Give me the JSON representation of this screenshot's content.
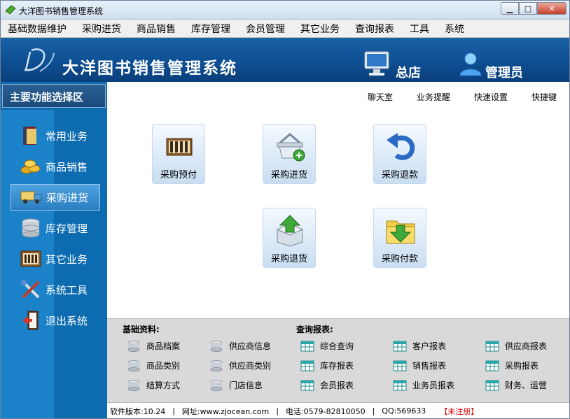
{
  "window": {
    "title": "大洋图书销售管理系统"
  },
  "menubar": {
    "items": [
      "基础数据维护",
      "采购进货",
      "商品销售",
      "库存管理",
      "会员管理",
      "其它业务",
      "查询报表",
      "工具",
      "系统"
    ]
  },
  "banner": {
    "title": "大洋图书销售管理系统",
    "branch": "总店",
    "role": "管理员"
  },
  "sidebar": {
    "header": "主要功能选择区",
    "items": [
      {
        "label": "常用业务",
        "icon": "book-icon"
      },
      {
        "label": "商品销售",
        "icon": "coins-icon"
      },
      {
        "label": "采购进货",
        "icon": "truck-icon"
      },
      {
        "label": "库存管理",
        "icon": "database-icon"
      },
      {
        "label": "其它业务",
        "icon": "abacus-icon"
      },
      {
        "label": "系统工具",
        "icon": "tools-icon"
      },
      {
        "label": "退出系统",
        "icon": "exit-door-icon"
      }
    ],
    "active_index": 2
  },
  "quick_links": [
    "聊天室",
    "业务提醒",
    "快速设置",
    "快捷键"
  ],
  "tiles": [
    {
      "label": "采购预付",
      "icon": "abacus-icon"
    },
    {
      "label": "采购进货",
      "icon": "basket-add-icon"
    },
    {
      "label": "采购退款",
      "icon": "undo-arrow-icon"
    },
    {
      "label": "采购退货",
      "icon": "box-up-arrow-icon"
    },
    {
      "label": "采购付款",
      "icon": "folder-down-arrow-icon"
    }
  ],
  "basic_info": {
    "title": "基础资料:",
    "links": [
      "商品档案",
      "供应商信息",
      "商品类别",
      "供应商类别",
      "结算方式",
      "门店信息"
    ]
  },
  "reports": {
    "title": "查询报表:",
    "links": [
      "综合查询",
      "客户报表",
      "供应商报表",
      "库存报表",
      "销售报表",
      "采购报表",
      "会员报表",
      "业务员报表",
      "财务、运营"
    ]
  },
  "status": {
    "version": "软件版本:10.24",
    "website": "网址:www.zjocean.com",
    "phone": "电话:0579-82810050",
    "qq": "QQ:569633",
    "registration": "【未注册】"
  }
}
